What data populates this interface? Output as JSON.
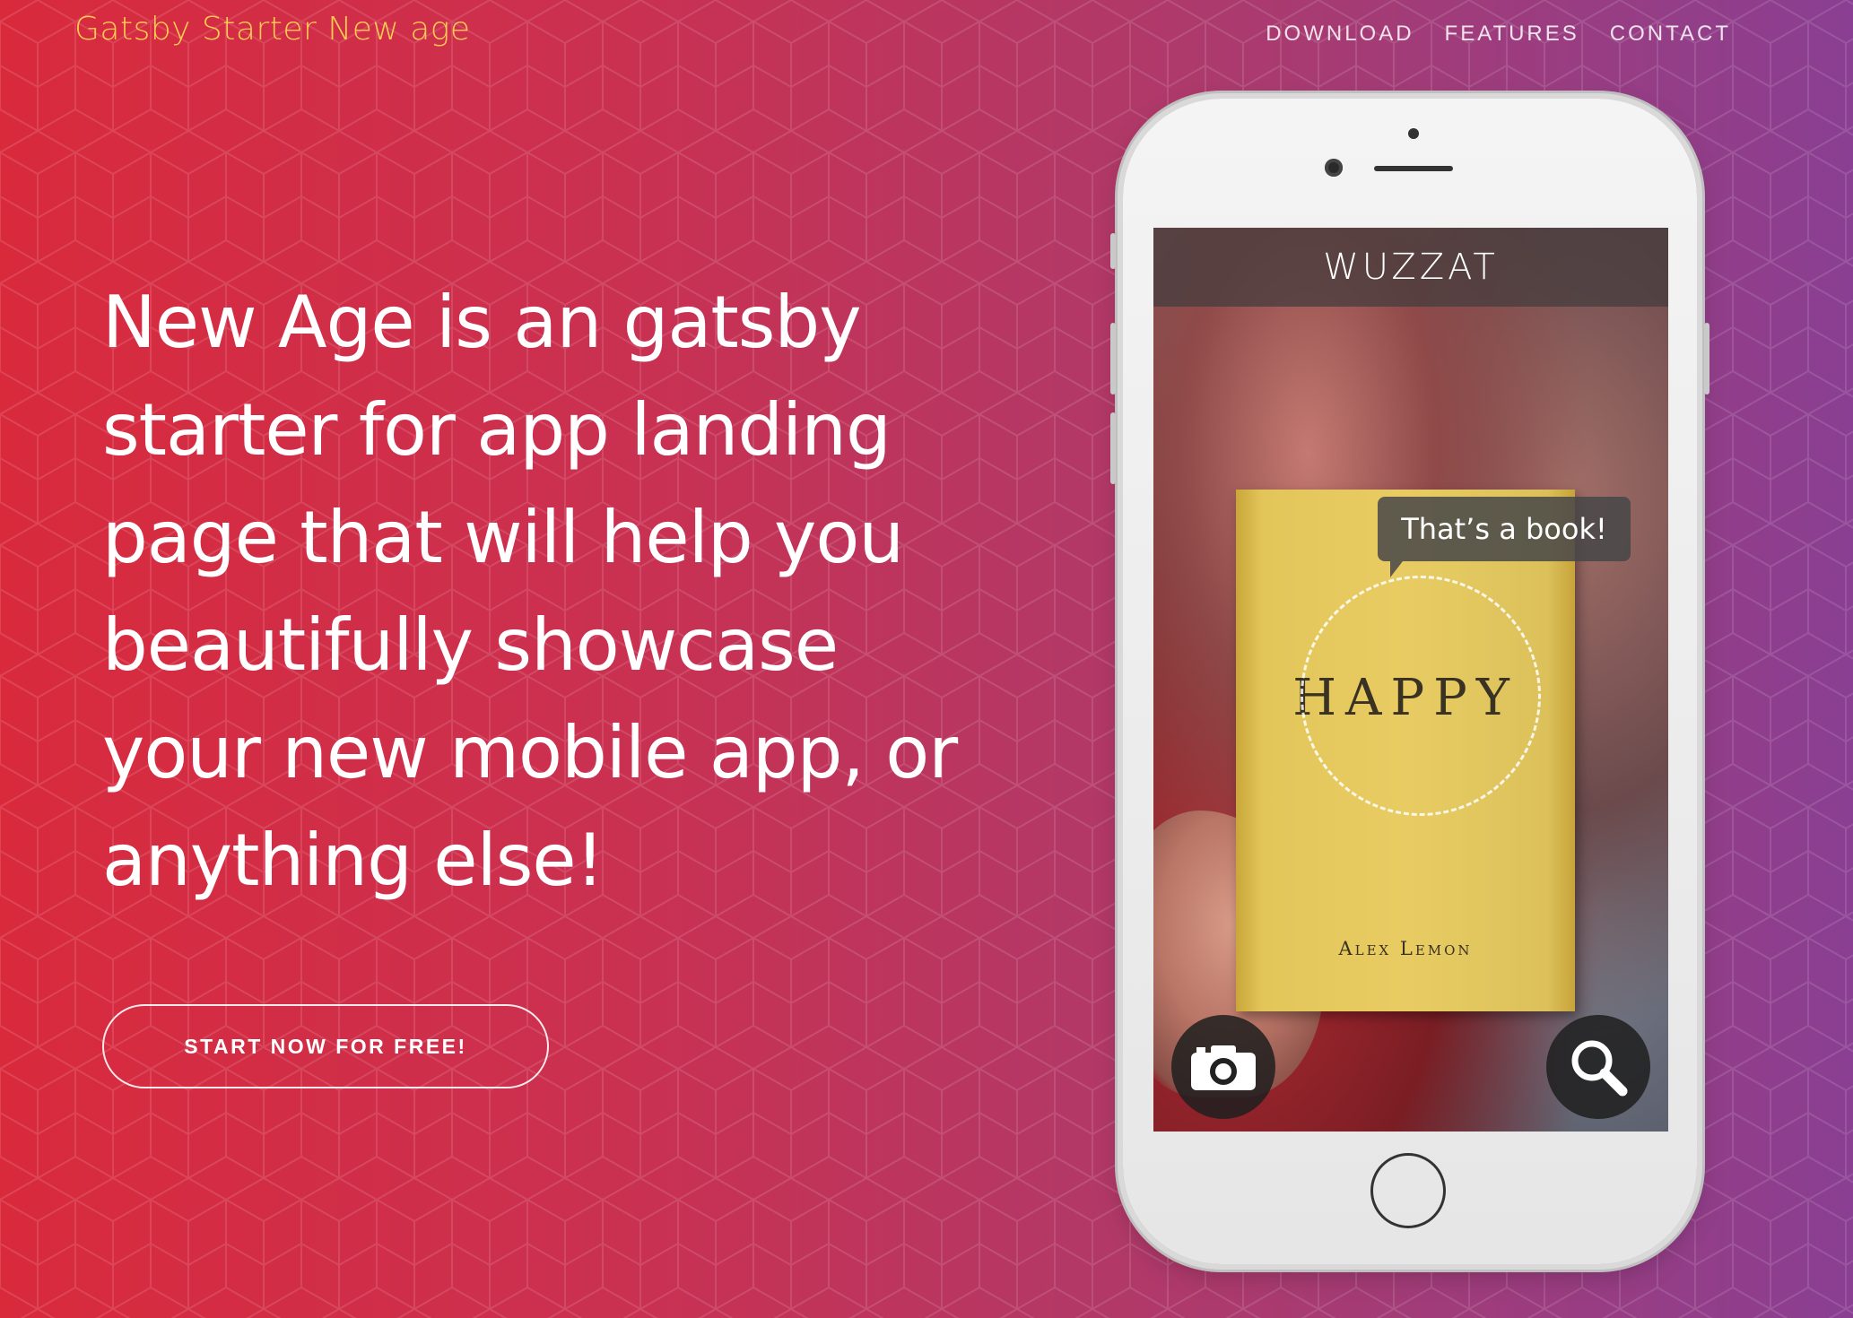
{
  "brand": "Gatsby Starter New age",
  "nav": {
    "items": [
      "DOWNLOAD",
      "FEATURES",
      "CONTACT"
    ]
  },
  "hero": {
    "headline": "New Age is an gatsby starter for app landing page that will help you beautifully showcase your new mobile app, or anything else!",
    "cta_label": "START NOW FOR FREE!"
  },
  "phone": {
    "app_title": "WUZZAT",
    "bubble_text": "That’s a book!",
    "book_title": "HAPPY",
    "book_author": "Alex Lemon",
    "left_button_icon": "camera-icon",
    "right_button_icon": "search-icon"
  },
  "colors": {
    "brand": "#fdcc52",
    "gradient_start": "#d92a3c",
    "gradient_end": "#8a3f92"
  }
}
